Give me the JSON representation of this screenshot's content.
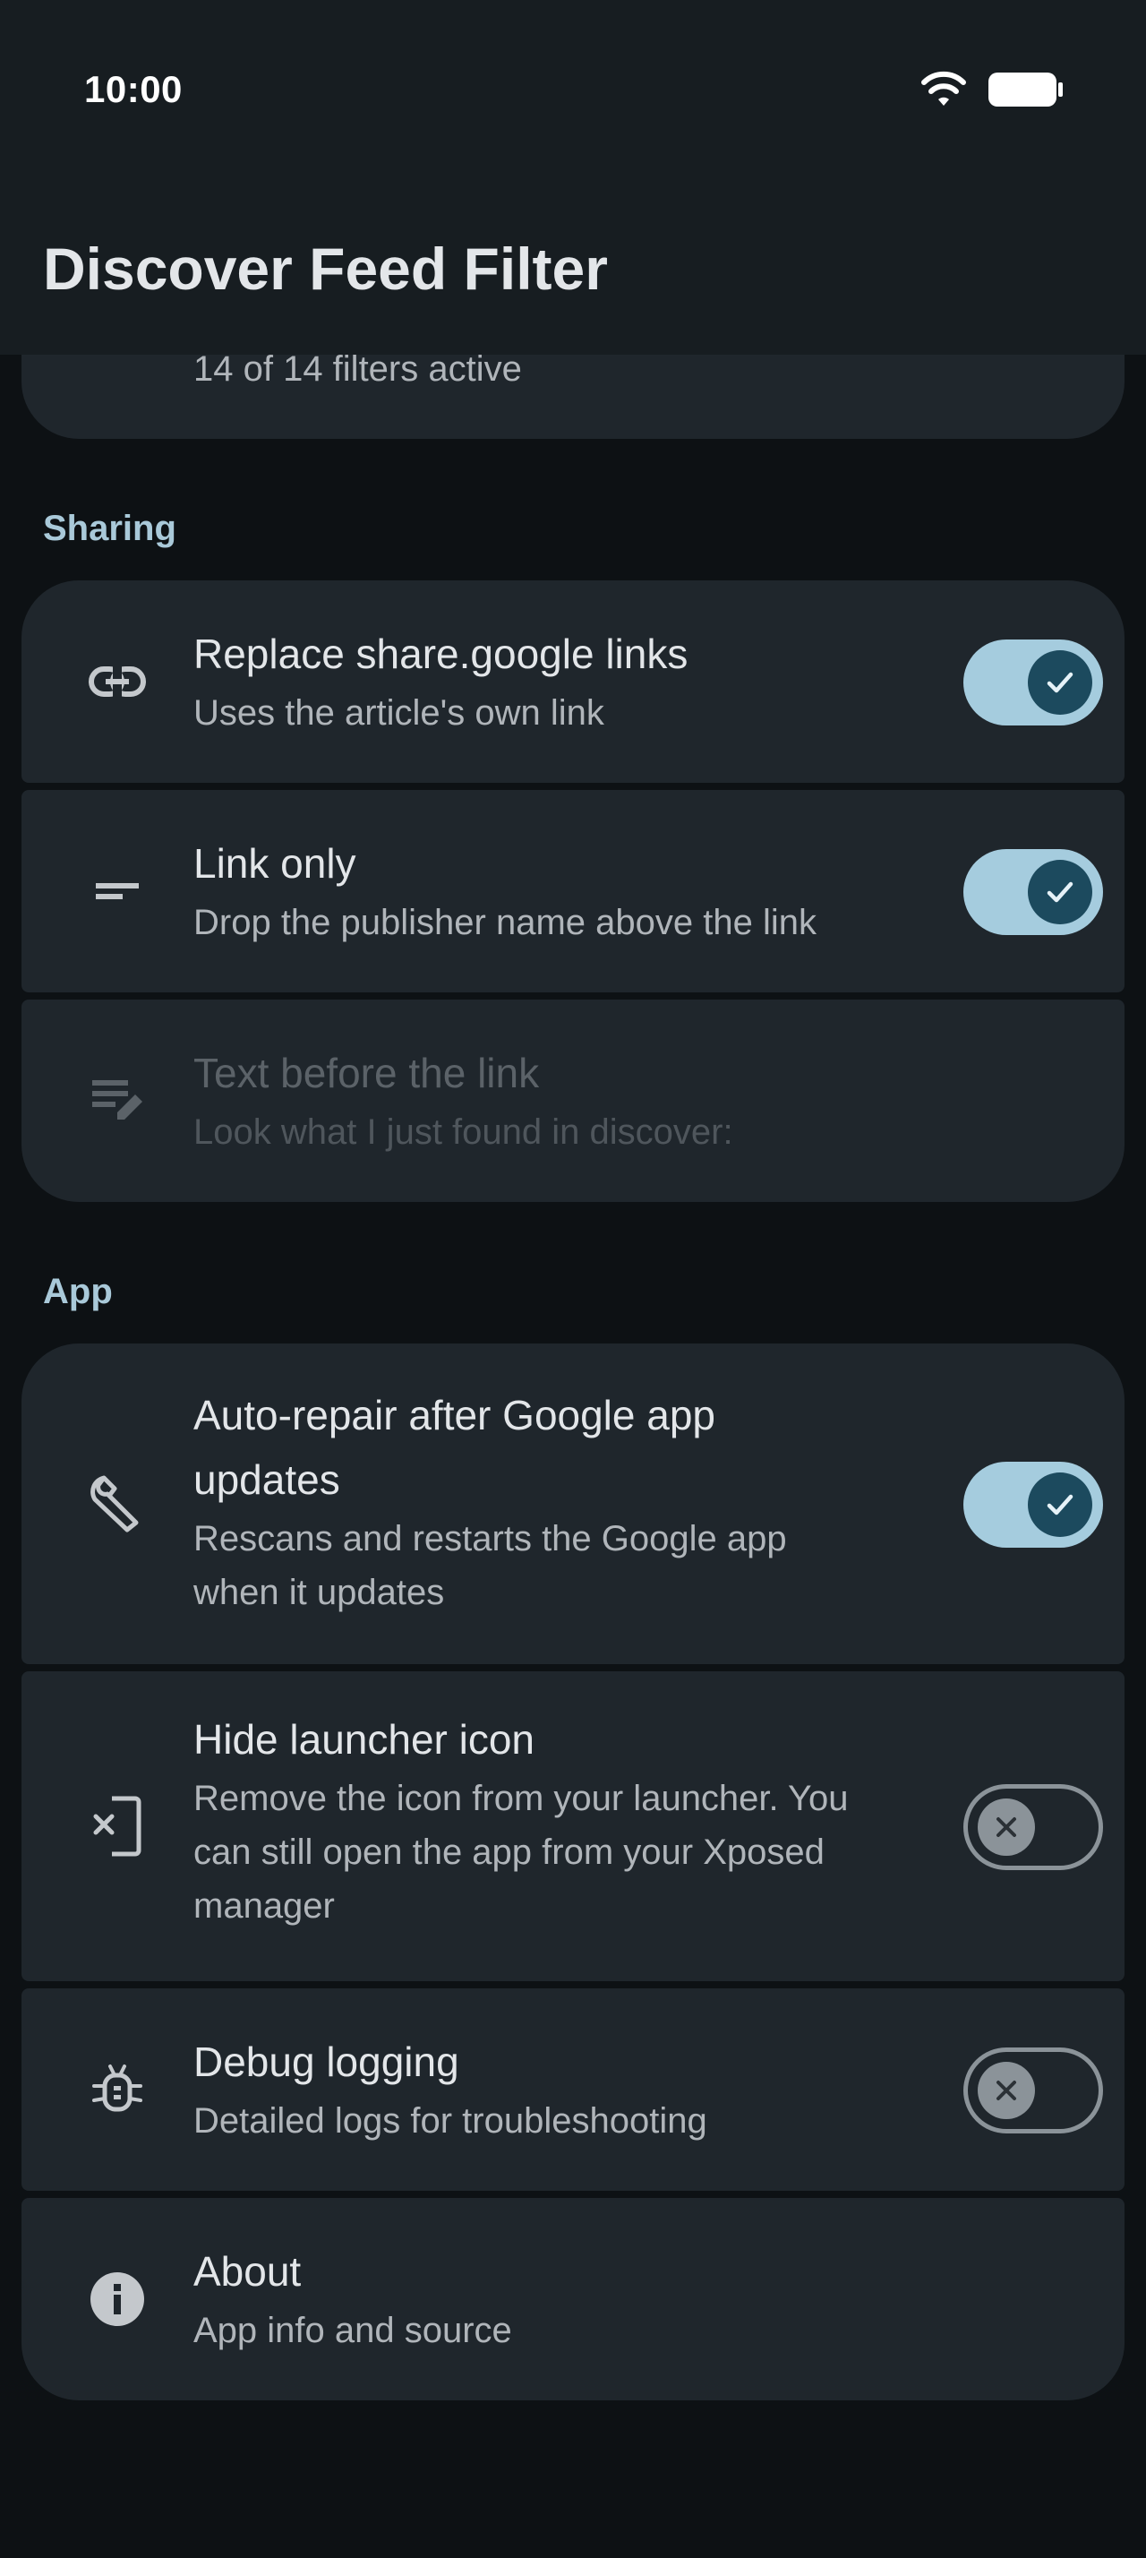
{
  "status_bar": {
    "time": "10:00"
  },
  "app_bar": {
    "title": "Discover Feed Filter"
  },
  "filters_card": {
    "subtitle": "14 of 14 filters active"
  },
  "sections": {
    "sharing": "Sharing",
    "app": "App"
  },
  "sharing_items": [
    {
      "title": "Replace share.google links",
      "subtitle": "Uses the article's own link",
      "toggle": "on",
      "icon": "link-icon"
    },
    {
      "title": "Link only",
      "subtitle": "Drop the publisher name above the link",
      "toggle": "on",
      "icon": "short-text-icon"
    },
    {
      "title": "Text before the link",
      "subtitle": "Look what I just found in discover:",
      "enabled": false,
      "icon": "edit-note-icon"
    }
  ],
  "app_items": [
    {
      "title_line1": "Auto-repair after Google app",
      "title_line2": "updates",
      "subtitle_line1": "Rescans and restarts the Google app",
      "subtitle_line2": "when it updates",
      "toggle": "on",
      "icon": "wrench-icon"
    },
    {
      "title": "Hide launcher icon",
      "subtitle_line1": "Remove the icon from your launcher. You",
      "subtitle_line2": "can still open the app from your Xposed",
      "subtitle_line3": "manager",
      "toggle": "off",
      "icon": "app-blocked-icon"
    },
    {
      "title": "Debug logging",
      "subtitle": "Detailed logs for troubleshooting",
      "toggle": "off",
      "icon": "bug-icon"
    },
    {
      "title": "About",
      "subtitle": "App info and source",
      "icon": "info-icon"
    }
  ],
  "colors": {
    "background": "#0d1114",
    "card": "#1f262c",
    "toggle_on_track": "#a5ccde",
    "toggle_on_knob": "#1c4a5e",
    "section_header": "#a9c9d9"
  }
}
